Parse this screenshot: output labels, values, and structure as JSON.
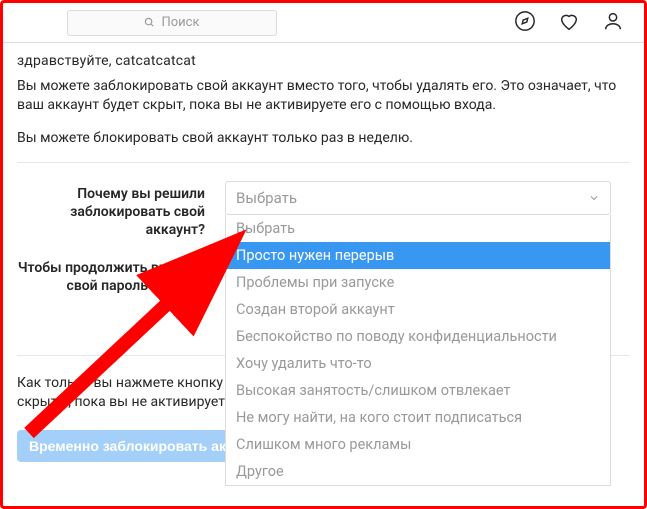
{
  "topbar": {
    "search_placeholder": "Поиск"
  },
  "cutoff_text": "---------------, ------------.",
  "para1": "Вы можете заблокировать свой аккаунт вместо того, чтобы удалять его. Это означает, что ваш аккаунт будет скрыт, пока вы не активируете его с помощью входа.",
  "para2": "Вы можете блокировать свой аккаунт только раз в неделю.",
  "form": {
    "reason_label": "Почему вы решили заблокировать свой аккаунт?",
    "password_label": "Чтобы продолжить введите свой пароль еще раз",
    "select_placeholder": "Выбрать",
    "options": [
      "Выбрать",
      "Просто нужен перерыв",
      "Проблемы при запуске",
      "Создан второй аккаунт",
      "Беспокойство по поводу конфиденциальности",
      "Хочу удалить что-то",
      "Высокая занятость/слишком отвлекает",
      "Не могу найти, на кого стоит подписаться",
      "Слишком много рекламы",
      "Другое"
    ],
    "highlighted_index": 1
  },
  "bottom_para": "Как только вы нажмете кнопку ниже, ваши фотографии, комментарии и отметки будут скрыты, пока вы не активируете свой аккаунт повторно.",
  "disable_button": "Временно заблокировать аккаунт"
}
